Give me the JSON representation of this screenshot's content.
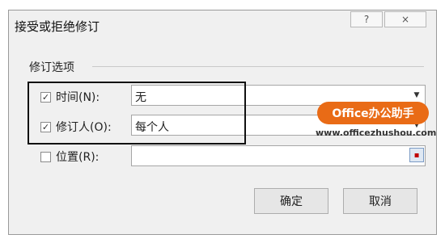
{
  "dialog": {
    "title": "接受或拒绝修订",
    "help_label": "?",
    "close_label": "×"
  },
  "group": {
    "label": "修订选项"
  },
  "options": [
    {
      "label": "时间(N):",
      "checked": true,
      "value": "无",
      "checkmark": "✓"
    },
    {
      "label": "修订人(O):",
      "checked": true,
      "value": "每个人",
      "checkmark": "✓"
    },
    {
      "label": "位置(R):",
      "checked": false,
      "value": ""
    }
  ],
  "dropdown_icon": "▼",
  "buttons": {
    "ok": "确定",
    "cancel": "取消"
  },
  "watermark": {
    "badge": "Office办公助手",
    "url": "www.officezhushou.com"
  }
}
